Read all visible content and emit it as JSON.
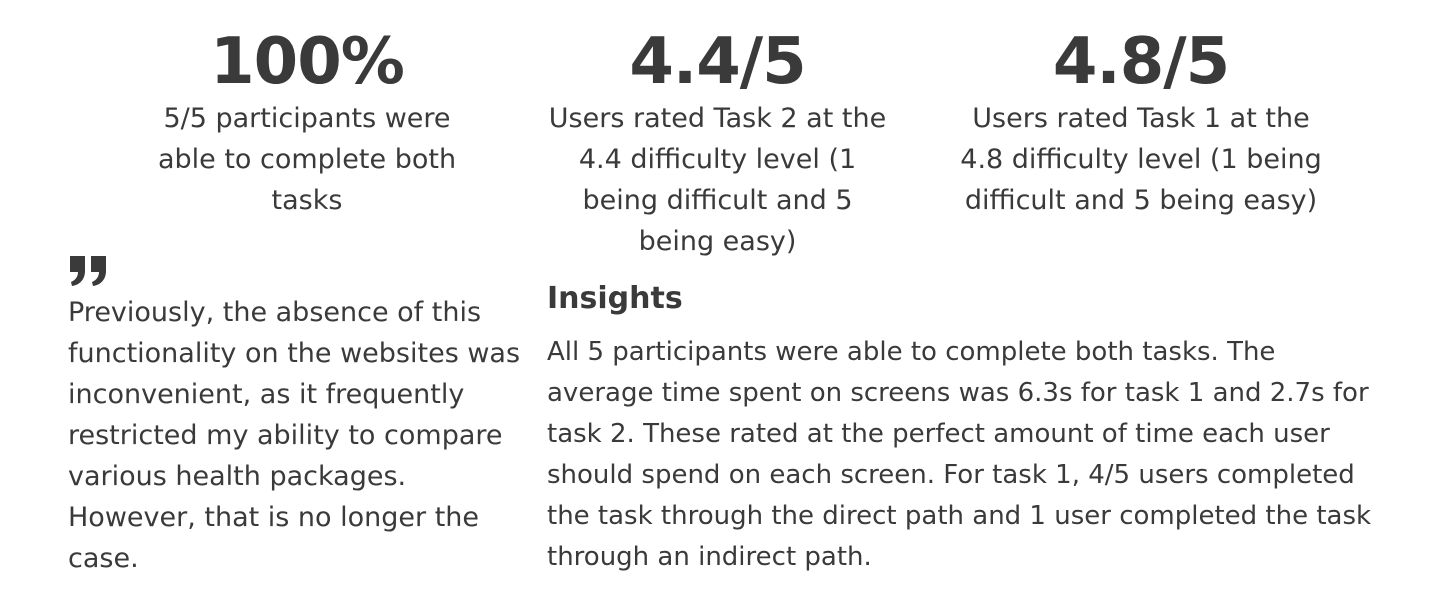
{
  "stats": [
    {
      "value": "100%",
      "description": "5/5 participants were able to complete both tasks"
    },
    {
      "value": "4.4/5",
      "description": "Users rated Task 2 at the 4.4 difficulty level (1 being difficult and 5 being easy)"
    },
    {
      "value": "4.8/5",
      "description": "Users rated Task 1 at the 4.8 difficulty level (1 being difficult and 5 being easy)"
    }
  ],
  "quote": {
    "icon": "quote-icon",
    "text": "Previously, the absence of this functionality on the websites was inconvenient, as it frequently restricted my ability to compare various health packages. However, that is no longer the case."
  },
  "insights": {
    "title": "Insights",
    "body": "All 5 participants were able to complete both tasks. The average time spent on screens was 6.3s for task 1 and 2.7s for task 2. These rated at the perfect amount of time each user should spend on each screen. For task 1, 4/5 users completed the task through the direct path and 1 user completed the task through an indirect path."
  },
  "colors": {
    "text": "#3a3a3a",
    "background": "#ffffff"
  }
}
